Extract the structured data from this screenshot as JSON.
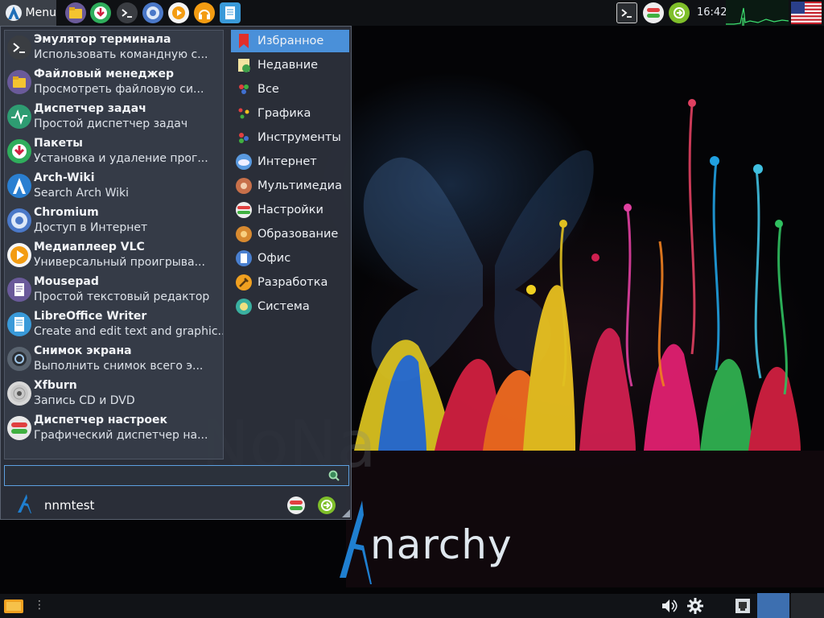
{
  "top_panel": {
    "menu_label": "Menu",
    "launchers": [
      "file-manager-icon",
      "packages-icon",
      "terminal-icon",
      "chromium-icon",
      "vlc-icon",
      "headphones-icon",
      "writer-icon"
    ],
    "clock": "16:42",
    "keyboard_layout_flag": "us-flag-icon"
  },
  "menu": {
    "favorites": [
      {
        "name": "Эмулятор терминала",
        "desc": "Использовать командную с...",
        "icon": "terminal-icon",
        "color": "#3a3d42"
      },
      {
        "name": "Файловый менеджер",
        "desc": "Просмотреть файловую си...",
        "icon": "folder-icon",
        "color": "#6a5a9a"
      },
      {
        "name": "Диспетчер задач",
        "desc": "Простой диспетчер задач",
        "icon": "task-manager-icon",
        "color": "#2e9c72"
      },
      {
        "name": "Пакеты",
        "desc": "Установка и удаление прог...",
        "icon": "packages-icon",
        "color": "#2fae5c"
      },
      {
        "name": "Arch-Wiki",
        "desc": "Search Arch Wiki",
        "icon": "arch-icon",
        "color": "#2a7fd1"
      },
      {
        "name": "Chromium",
        "desc": "Доступ в Интернет",
        "icon": "chromium-icon",
        "color": "#4a78c8"
      },
      {
        "name": "Медиаплеер VLC",
        "desc": "Универсальный проигрыва...",
        "icon": "vlc-icon",
        "color": "#f5f5f5"
      },
      {
        "name": "Mousepad",
        "desc": "Простой текстовый редактор",
        "icon": "text-editor-icon",
        "color": "#6a5a9a"
      },
      {
        "name": "LibreOffice Writer",
        "desc": "Create and edit text and graphic...",
        "icon": "writer-icon",
        "color": "#3a9ad9"
      },
      {
        "name": "Снимок экрана",
        "desc": "Выполнить снимок всего э...",
        "icon": "screenshot-icon",
        "color": "#5a6470"
      },
      {
        "name": "Xfburn",
        "desc": "Запись CD и DVD",
        "icon": "disc-icon",
        "color": "#d8d8d8"
      },
      {
        "name": "Диспетчер настроек",
        "desc": "Графический диспетчер на...",
        "icon": "settings-manager-icon",
        "color": "#e8e8e8"
      }
    ],
    "categories": [
      {
        "label": "Избранное",
        "icon": "bookmark-icon",
        "active": true
      },
      {
        "label": "Недавние",
        "icon": "recent-icon",
        "active": false
      },
      {
        "label": "Все",
        "icon": "all-apps-icon",
        "active": false
      },
      {
        "label": "Графика",
        "icon": "graphics-icon",
        "active": false
      },
      {
        "label": "Инструменты",
        "icon": "tools-icon",
        "active": false
      },
      {
        "label": "Интернет",
        "icon": "internet-icon",
        "active": false
      },
      {
        "label": "Мультимедиа",
        "icon": "multimedia-icon",
        "active": false
      },
      {
        "label": "Настройки",
        "icon": "settings-icon",
        "active": false
      },
      {
        "label": "Образование",
        "icon": "education-icon",
        "active": false
      },
      {
        "label": "Офис",
        "icon": "office-icon",
        "active": false
      },
      {
        "label": "Разработка",
        "icon": "development-icon",
        "active": false
      },
      {
        "label": "Система",
        "icon": "system-icon",
        "active": false
      }
    ],
    "search": {
      "value": "",
      "placeholder": ""
    },
    "user": {
      "name": "nnmtest"
    }
  },
  "wallpaper": {
    "logo_text": "narchy"
  },
  "colors": {
    "accent": "#4a90d9",
    "panel": "#0f1114",
    "menu_bg": "#2d323c"
  }
}
